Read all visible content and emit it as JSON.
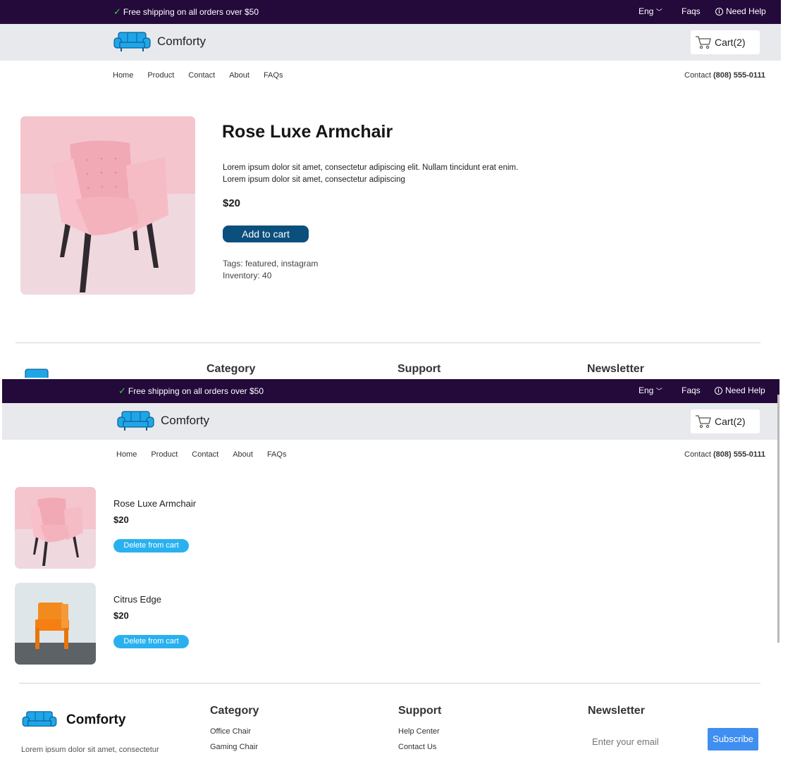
{
  "topbar": {
    "shipping_text": "Free shipping on all orders over $50",
    "language": "Eng",
    "faqs": "Faqs",
    "help": "Need Help"
  },
  "header": {
    "logo_text": "Comforty",
    "cart_label": "Cart(2)"
  },
  "nav": {
    "links": [
      "Home",
      "Product",
      "Contact",
      "About",
      "FAQs"
    ],
    "contact_label": "Contact",
    "contact_phone": "(808) 555-0111"
  },
  "product": {
    "title": "Rose Luxe Armchair",
    "description_line1": "Lorem ipsum dolor sit amet, consectetur adipiscing elit. Nullam tincidunt erat enim.",
    "description_line2": "Lorem ipsum dolor sit amet, consectetur adipiscing",
    "price": "$20",
    "add_to_cart": "Add to cart",
    "tags": "Tags: featured, instagram",
    "inventory": "Inventory: 40"
  },
  "cart": {
    "items": [
      {
        "name": "Rose Luxe Armchair",
        "price": "$20",
        "delete_label": "Delete from cart"
      },
      {
        "name": "Citrus Edge",
        "price": "$20",
        "delete_label": "Delete from cart"
      }
    ]
  },
  "footer": {
    "logo_text": "Comforty",
    "lorem": "Lorem ipsum dolor sit amet, consectetur",
    "category": {
      "heading": "Category",
      "links": [
        "Office Chair",
        "Gaming Chair"
      ]
    },
    "support": {
      "heading": "Support",
      "links": [
        "Help Center",
        "Contact Us"
      ]
    },
    "newsletter": {
      "heading": "Newsletter",
      "placeholder": "Enter your email",
      "subscribe": "Subscribe"
    }
  },
  "colors": {
    "topbar_bg": "#230a3b",
    "header_bg": "#e8e9ec",
    "add_to_cart_bg": "#0b4f7d",
    "delete_bg": "#29b1ef",
    "subscribe_bg": "#3f8ef0",
    "logo_blue": "#1fa6e8"
  }
}
